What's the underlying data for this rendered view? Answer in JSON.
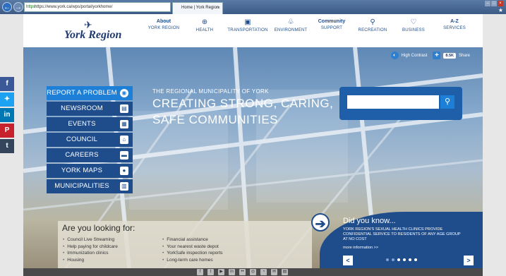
{
  "browser": {
    "address": "https://www.york.ca/wps/portal/yorkhome/",
    "https_label": "https",
    "tab_title": "Home | York Region"
  },
  "header": {
    "logo_text": "York Region",
    "nav": [
      {
        "top": "About",
        "label": "YORK REGION",
        "icon": "none"
      },
      {
        "top": "",
        "label": "HEALTH",
        "icon": "health-icon"
      },
      {
        "top": "",
        "label": "TRANSPORTATION",
        "icon": "transportation-icon"
      },
      {
        "top": "",
        "label": "ENVIRONMENT",
        "icon": "environment-icon"
      },
      {
        "top": "Community",
        "label": "SUPPORT",
        "icon": "none"
      },
      {
        "top": "",
        "label": "RECREATION",
        "icon": "recreation-icon"
      },
      {
        "top": "",
        "label": "BUSINESS",
        "icon": "business-icon"
      },
      {
        "top": "A-Z",
        "label": "SERVICES",
        "icon": "none"
      }
    ]
  },
  "utility": {
    "high_contrast": "High Contrast",
    "share_count": "8.5K",
    "share_label": "Share"
  },
  "quick_menu": [
    {
      "label": "REPORT A PROBLEM",
      "icon": "camera-icon"
    },
    {
      "label": "NEWSROOM",
      "icon": "newspaper-icon"
    },
    {
      "label": "EVENTS",
      "icon": "calendar-icon"
    },
    {
      "label": "COUNCIL",
      "icon": "building-icon"
    },
    {
      "label": "CAREERS",
      "icon": "briefcase-icon"
    },
    {
      "label": "YORK MAPS",
      "icon": "map-pin-icon"
    },
    {
      "label": "MUNICIPALITIES",
      "icon": "city-icon"
    }
  ],
  "hero": {
    "kicker": "THE REGIONAL MUNICIPALITY OF YORK",
    "headline_line1": "CREATING STRONG, CARING,",
    "headline_line2": "SAFE COMMUNITIES"
  },
  "search": {
    "placeholder": ""
  },
  "looking_for": {
    "title": "Are you looking for:",
    "col1": [
      "Council Live Streaming",
      "Help paying for childcare",
      "Immunization clinics",
      "Housing"
    ],
    "col2": [
      "Financial assistance",
      "Your nearest waste depot",
      "YorkSafe inspection reports",
      "Long-term care homes"
    ]
  },
  "did_you_know": {
    "title": "Did you know...",
    "body": "York Region's sexual health clinics provide confidential service to residents of any age group at no cost",
    "more": "more information >>",
    "prev": "<",
    "next": ">"
  },
  "social": [
    "f",
    "t",
    "in",
    "P",
    "t"
  ],
  "colors": {
    "brand_navy": "#1f4d8c",
    "brand_blue": "#1e7fd6"
  }
}
